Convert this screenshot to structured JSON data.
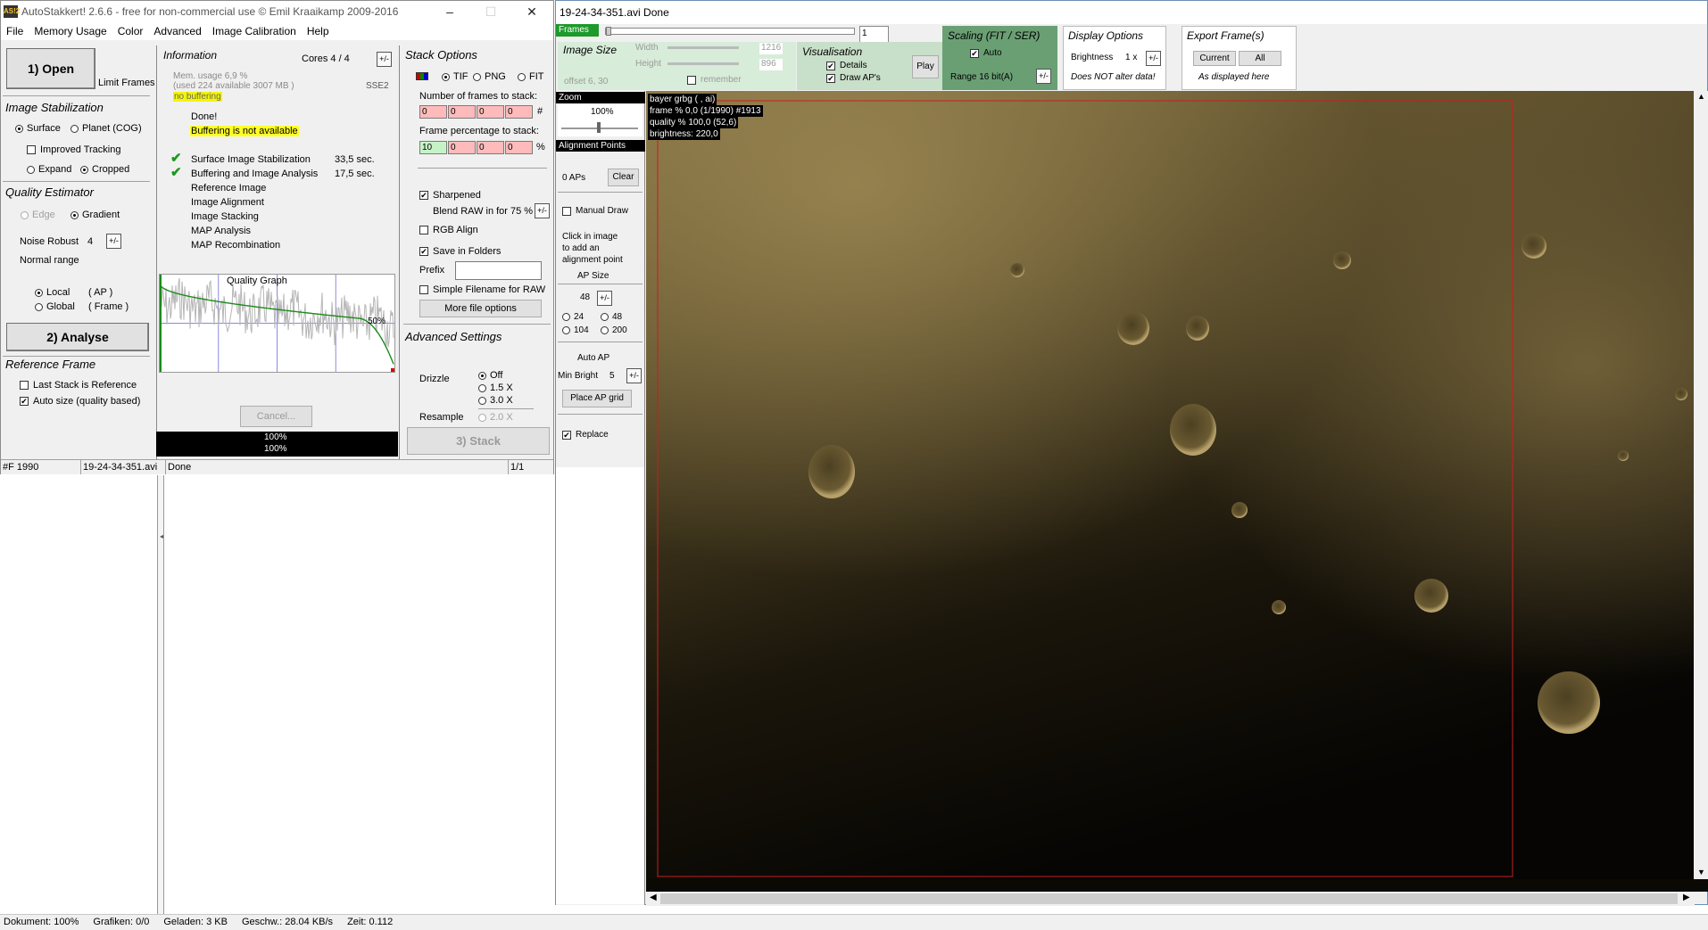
{
  "main_window": {
    "title": "AutoStakkert! 2.6.6 - free for non-commercial use © Emil Kraaikamp 2009-2016",
    "icon_text": "AS!2",
    "menu": [
      "File",
      "Memory Usage",
      "Color",
      "Advanced",
      "Image Calibration",
      "Help"
    ],
    "open_button": "1) Open",
    "limit_frames": "Limit Frames",
    "image_stabilization": {
      "heading": "Image Stabilization",
      "surface": "Surface",
      "planet": "Planet (COG)",
      "improved_tracking": "Improved Tracking",
      "expand": "Expand",
      "cropped": "Cropped"
    },
    "quality_estimator": {
      "heading": "Quality Estimator",
      "edge": "Edge",
      "gradient": "Gradient",
      "noise_robust_label": "Noise Robust",
      "noise_robust_value": "4",
      "normal_range": "Normal range",
      "local": "Local",
      "local_ap": "( AP )",
      "global": "Global",
      "global_frame": "( Frame )"
    },
    "analyse_button": "2) Analyse",
    "reference_frame": {
      "heading": "Reference Frame",
      "last_stack": "Last Stack is Reference",
      "auto_size": "Auto size (quality based)"
    },
    "information": {
      "heading": "Information",
      "cores": "Cores 4 / 4",
      "mem_usage": "Mem. usage 6,9 %",
      "mem_detail": "(used 224 available 3007 MB )",
      "sse": "SSE2",
      "no_buffering": "no buffering",
      "done": "Done!",
      "buffering_na": "Buffering is not available",
      "tasks": [
        {
          "name": "Surface Image Stabilization",
          "time": "33,5 sec.",
          "done": true
        },
        {
          "name": "Buffering and Image Analysis",
          "time": "17,5 sec.",
          "done": true
        },
        {
          "name": "Reference Image",
          "time": "",
          "done": false
        },
        {
          "name": "Image Alignment",
          "time": "",
          "done": false
        },
        {
          "name": "Image Stacking",
          "time": "",
          "done": false
        },
        {
          "name": "MAP Analysis",
          "time": "",
          "done": false
        },
        {
          "name": "MAP Recombination",
          "time": "",
          "done": false
        }
      ]
    },
    "quality_graph": {
      "title": "Quality Graph",
      "marker": "50%"
    },
    "cancel_button": "Cancel...",
    "progress": [
      "100%",
      "100%"
    ],
    "stack_options": {
      "heading": "Stack Options",
      "formats": [
        "TIF",
        "PNG",
        "FIT"
      ],
      "frames_to_stack_label": "Number of frames to stack:",
      "frames_to_stack": [
        "0",
        "0",
        "0",
        "0"
      ],
      "frames_unit": "#",
      "frame_pct_label": "Frame percentage to stack:",
      "frame_pct": [
        "10",
        "0",
        "0",
        "0"
      ],
      "pct_unit": "%",
      "sharpened": "Sharpened",
      "blend_raw": "Blend RAW in for 75 %",
      "rgb_align": "RGB Align",
      "save_in_folders": "Save in Folders",
      "prefix_label": "Prefix",
      "prefix_value": "",
      "simple_filename": "Simple Filename for RAW",
      "more_file_options": "More file options"
    },
    "advanced_settings": {
      "heading": "Advanced Settings",
      "drizzle_label": "Drizzle",
      "drizzle_opts": [
        "Off",
        "1.5 X",
        "3.0 X"
      ],
      "resample_label": "Resample",
      "resample_opt": "2.0 X"
    },
    "stack_button": "3) Stack",
    "status": {
      "frame_count": "#F 1990",
      "file": "19-24-34-351.avi",
      "state": "Done",
      "page": "1/1"
    }
  },
  "image_window": {
    "title": "19-24-34-351.avi  Done",
    "frames_label": "Frames",
    "frame_value": "1",
    "image_size": {
      "heading": "Image Size",
      "width_label": "Width",
      "width_value": "1216",
      "height_label": "Height",
      "height_value": "896",
      "offset": "offset    6, 30",
      "remember": "remember"
    },
    "visualisation": {
      "heading": "Visualisation",
      "details": "Details",
      "draw_aps": "Draw AP's",
      "play": "Play"
    },
    "scaling": {
      "heading": "Scaling (FIT / SER)",
      "auto": "Auto",
      "range": "Range 16 bit(A)"
    },
    "display_options": {
      "heading": "Display Options",
      "brightness_label": "Brightness",
      "brightness_value": "1 x",
      "note": "Does NOT alter data!"
    },
    "export": {
      "heading": "Export Frame(s)",
      "current": "Current",
      "all": "All",
      "note": "As displayed here"
    },
    "zoom": {
      "heading": "Zoom",
      "value": "100%"
    },
    "alignment_points": {
      "heading": "Alignment Points",
      "count": "0 APs",
      "clear": "Clear",
      "manual_draw": "Manual Draw",
      "hint": [
        "Click in image",
        "to add an",
        "alignment point"
      ],
      "ap_size_label": "AP Size",
      "ap_size_value": "48",
      "ap_sizes": [
        "24",
        "48",
        "104",
        "200"
      ],
      "auto_ap": "Auto AP",
      "min_bright_label": "Min Bright",
      "min_bright_value": "5",
      "place_grid": "Place AP grid",
      "replace": "Replace"
    },
    "overlay": [
      "bayer grbg ( , ai)",
      "frame % 0,0  (1/1990) #1913",
      "quality % 100,0  (52,6)",
      "brightness: 220,0"
    ]
  },
  "browser_status": {
    "dokument": "Dokument: 100%",
    "grafiken": "Grafiken: 0/0",
    "geladen": "Geladen: 3 KB",
    "geschw": "Geschw.: 28.04 KB/s",
    "zeit": "Zeit: 0.112"
  }
}
